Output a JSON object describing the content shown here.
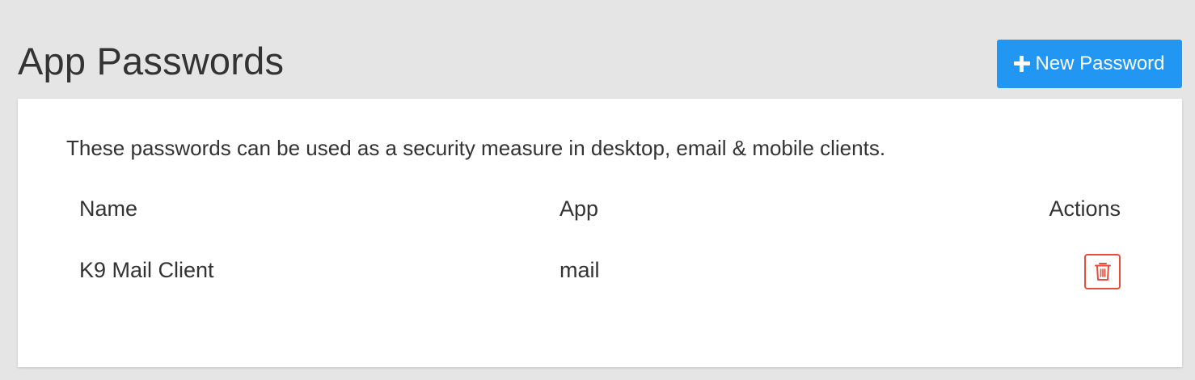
{
  "header": {
    "title": "App Passwords",
    "new_password_label": "New Password"
  },
  "card": {
    "description": "These passwords can be used as a security measure in desktop, email & mobile clients.",
    "table": {
      "columns": [
        "Name",
        "App",
        "Actions"
      ],
      "rows": [
        {
          "name": "K9 Mail Client",
          "app": "mail"
        }
      ]
    }
  },
  "colors": {
    "background": "#e5e5e5",
    "accent": "#2196f3",
    "danger": "#e74c3c"
  },
  "icons": {
    "new_button": "plus-icon",
    "delete_button": "trash-icon"
  }
}
